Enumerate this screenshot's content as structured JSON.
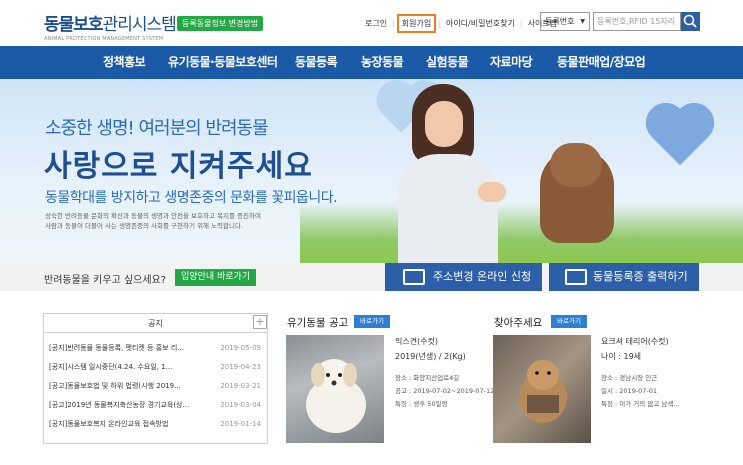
{
  "header": {
    "logo_title_bold": "동물보호",
    "logo_title_light": "관리시스템",
    "logo_subtitle": "ANIMAL PROTECTION MANAGEMENT SYSTEM",
    "guide_button": "등록동물정보 변경방법",
    "links": {
      "login": "로그인",
      "join": "회원가입",
      "find": "아이디/비밀번호찾기",
      "sitemap": "사이트맵"
    },
    "search_select": "등록번호",
    "search_placeholder": "등록번호,RFID 15자리"
  },
  "nav": [
    "정책홍보",
    "유기동물·동물보호센터",
    "동물등록",
    "농장동물",
    "실험동물",
    "자료마당",
    "동물판매업/장묘업"
  ],
  "hero": {
    "line1": "소중한 생명! 여러분의 반려동물",
    "line2": "사랑으로 지켜주세요",
    "line3": "동물학대를 방지하고 생명존중의 문화를 꽃피웁니다.",
    "line4a": "성숙한 반려동물 문화의 확산과 동물의 생명과 안전을 보호하고 복지를 증진하여",
    "line4b": "사람과 동물이 더불어 사는 생명존중의 사회를 구현하기 위해 노력합니다."
  },
  "strip": {
    "question": "반려동물을 키우고 싶으세요?",
    "adopt_button": "입양안내 바로가기",
    "address_button": "주소변경 온라인 신청",
    "print_button": "동물등록증 출력하기"
  },
  "notice": {
    "title": "공지",
    "plus": "+",
    "items": [
      {
        "title": "[공지]반려동물 동물등록, 펫티켓 등 홍보 리...",
        "date": "2019-05-09"
      },
      {
        "title": "[공지]시스템 일시중단(4.24. 수요일, 1...",
        "date": "2019-04-23"
      },
      {
        "title": "[공고]동물보호법 및 하위 법령(시행 2019...",
        "date": "2019-03-21"
      },
      {
        "title": "[공고]2019년 동물복지축산농장 경기교육(상...",
        "date": "2019-03-04"
      },
      {
        "title": "[공지]동물보호복지 온라인교육 접속방법",
        "date": "2019-01-14"
      }
    ]
  },
  "lost": {
    "title": "유기동물 공고",
    "more": "바로가기",
    "name": "믹스견(수컷)",
    "info": "2019(년생) / 2(Kg)",
    "place": "장소 : 화양지산업로4길",
    "period": "공고 : 2019-07-02~2019-07-12",
    "feature": "특징 : 생후 50일령"
  },
  "find": {
    "title": "찾아주세요",
    "more": "바로가기",
    "name": "요크셔 테리어(수컷)",
    "age": "나이 : 19세",
    "place": "장소 : 경남시장 인근",
    "date": "일시 : 2019-07-01",
    "feature": "특징 : 이가 거의 없고 남색..."
  },
  "colors": {
    "brand_blue": "#1b5aa6",
    "button_blue": "#2d5fa8",
    "green": "#23a845",
    "highlight_orange": "#f07c23"
  }
}
